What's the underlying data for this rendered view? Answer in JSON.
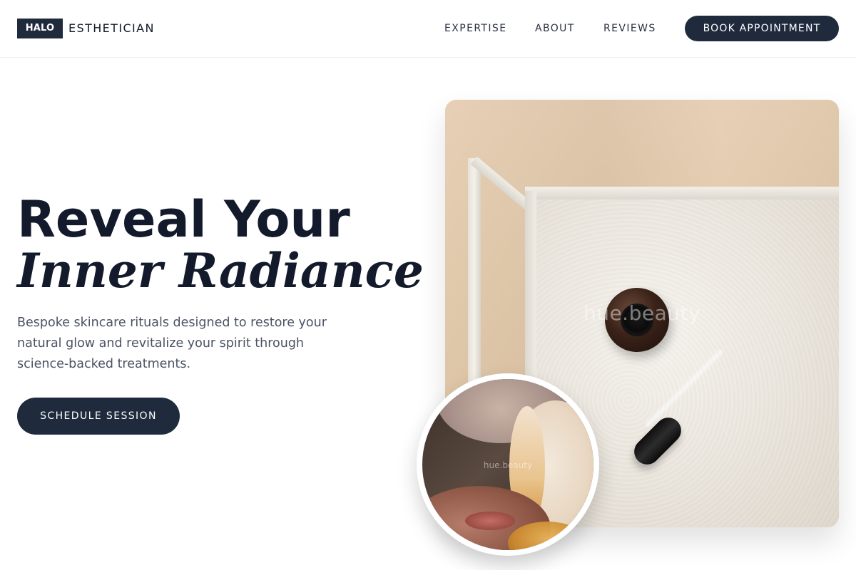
{
  "header": {
    "logo_mark": "HALO",
    "logo_word": "ESTHETICIAN",
    "nav": [
      {
        "label": "EXPERTISE"
      },
      {
        "label": "ABOUT"
      },
      {
        "label": "REVIEWS"
      }
    ],
    "cta_label": "BOOK APPOINTMENT"
  },
  "hero": {
    "title_line1": "Reveal Your",
    "title_line2": "Inner Radiance",
    "subtitle": "Bespoke skincare rituals designed to restore your natural glow and revitalize your spirit through science-backed treatments.",
    "cta_label": "SCHEDULE SESSION"
  },
  "images": {
    "main_watermark": "hue.beauty",
    "circle_watermark": "hue.beauty"
  },
  "colors": {
    "primary": "#1f2a3c",
    "text_dark": "#131a2b",
    "text_muted": "#4a5263",
    "background": "#ffffff"
  }
}
